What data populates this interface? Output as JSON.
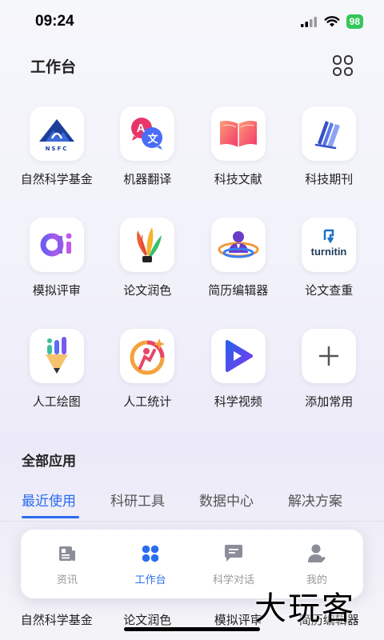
{
  "status_bar": {
    "time": "09:24",
    "battery": "98"
  },
  "header": {
    "title": "工作台"
  },
  "apps": [
    {
      "label": "自然科学基金",
      "icon": "nsfc-logo-icon"
    },
    {
      "label": "机器翻译",
      "icon": "translate-icon"
    },
    {
      "label": "科技文献",
      "icon": "open-book-icon"
    },
    {
      "label": "科技期刊",
      "icon": "journal-pages-icon"
    },
    {
      "label": "模拟评审",
      "icon": "ai-logo-icon"
    },
    {
      "label": "论文润色",
      "icon": "quill-pen-icon"
    },
    {
      "label": "简历编辑器",
      "icon": "resume-person-icon"
    },
    {
      "label": "论文查重",
      "icon": "turnitin-logo-icon"
    },
    {
      "label": "人工绘图",
      "icon": "drawing-pencil-icon"
    },
    {
      "label": "人工统计",
      "icon": "statistics-person-icon"
    },
    {
      "label": "科学视频",
      "icon": "video-play-icon"
    },
    {
      "label": "添加常用",
      "icon": "plus-icon"
    }
  ],
  "turnitin_text": "turnitin",
  "nsfc_text": "NSFC",
  "section": {
    "title": "全部应用"
  },
  "tabs": [
    {
      "label": "最近使用",
      "active": true
    },
    {
      "label": "科研工具",
      "active": false
    },
    {
      "label": "数据中心",
      "active": false
    },
    {
      "label": "解决方案",
      "active": false
    }
  ],
  "recent": [
    "自然科学基金",
    "论文润色",
    "模拟评审",
    "简历编辑器"
  ],
  "bottom_nav": [
    {
      "label": "资讯",
      "icon": "news-icon",
      "active": false
    },
    {
      "label": "工作台",
      "icon": "workbench-icon",
      "active": true
    },
    {
      "label": "科学对话",
      "icon": "chat-icon",
      "active": false
    },
    {
      "label": "我的",
      "icon": "profile-icon",
      "active": false
    }
  ],
  "watermark": "大玩客",
  "colors": {
    "accent": "#2a6cf0",
    "battery": "#34c759",
    "inactive": "#999999"
  }
}
